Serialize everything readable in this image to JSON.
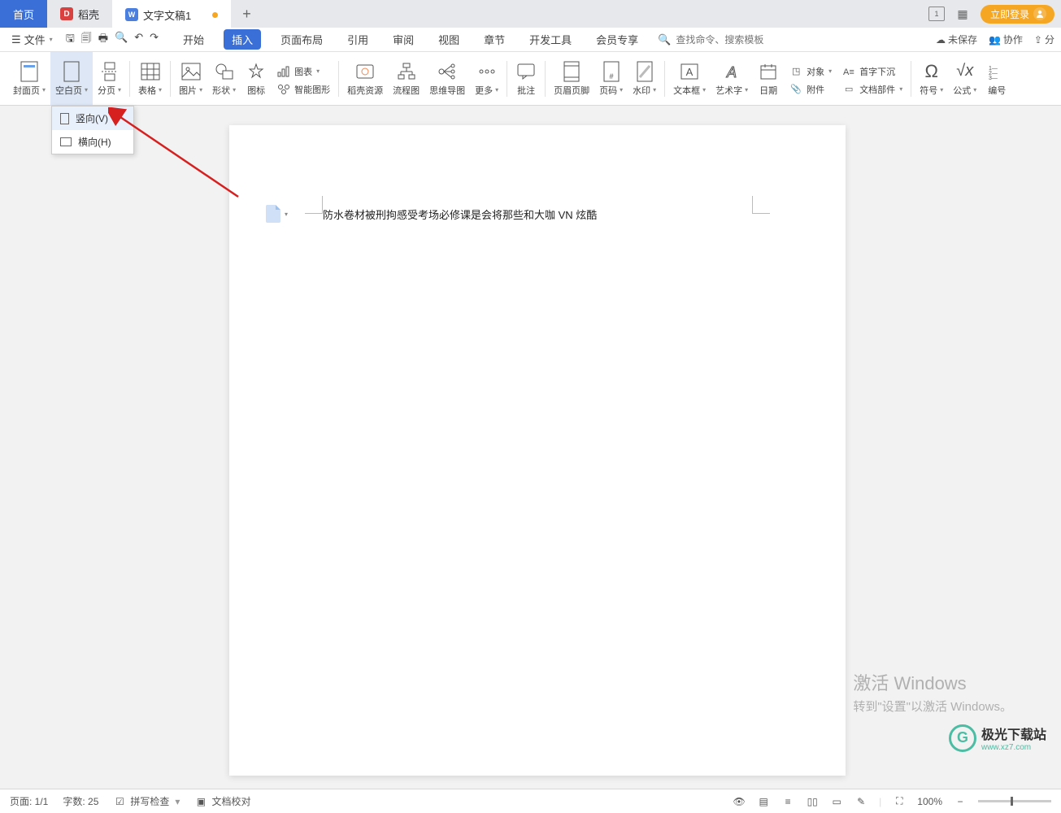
{
  "tabs": {
    "home": "首页",
    "docer": "稻壳",
    "doc": "文字文稿1",
    "plus": "+"
  },
  "login_btn": "立即登录",
  "menubar": {
    "file": "文件",
    "tabs": [
      "开始",
      "插入",
      "页面布局",
      "引用",
      "审阅",
      "视图",
      "章节",
      "开发工具",
      "会员专享"
    ],
    "active_tab_index": 1,
    "search_placeholder": "查找命令、搜索模板",
    "right": {
      "unsaved": "未保存",
      "collab": "协作",
      "share": "分"
    }
  },
  "ribbon": {
    "items": [
      {
        "label": "封面页"
      },
      {
        "label": "空白页"
      },
      {
        "label": "分页"
      },
      {
        "label": "表格"
      },
      {
        "label": "图片"
      },
      {
        "label": "形状"
      },
      {
        "label": "图标"
      },
      {
        "label": "智能图形"
      },
      {
        "label": "稻壳资源"
      },
      {
        "label": "流程图"
      },
      {
        "label": "思维导图"
      },
      {
        "label": "更多"
      },
      {
        "label": "批注"
      },
      {
        "label": "页眉页脚"
      },
      {
        "label": "页码"
      },
      {
        "label": "水印"
      },
      {
        "label": "文本框"
      },
      {
        "label": "艺术字"
      },
      {
        "label": "日期"
      },
      {
        "label": "附件"
      },
      {
        "label": "文档部件"
      },
      {
        "label": "符号"
      },
      {
        "label": "公式"
      },
      {
        "label": "编号"
      }
    ],
    "side_rows": {
      "chart": "图表",
      "object": "对象",
      "dropcap": "首字下沉"
    },
    "wordart_row": "艺术字"
  },
  "dropdown": {
    "vert": "竖向(V)",
    "horz": "横向(H)"
  },
  "document": {
    "text": "防水卷材被刑拘感受考场必修课是会将那些和大咖 VN 炫酷"
  },
  "statusbar": {
    "page": "页面: 1/1",
    "words": "字数: 25",
    "spellcheck": "拼写检查",
    "proof": "文档校对",
    "zoom": "100%"
  },
  "watermark": {
    "line1": "激活 Windows",
    "line2": "转到\"设置\"以激活 Windows。"
  },
  "logo": {
    "main": "极光下载站",
    "sub": "www.xz7.com"
  }
}
